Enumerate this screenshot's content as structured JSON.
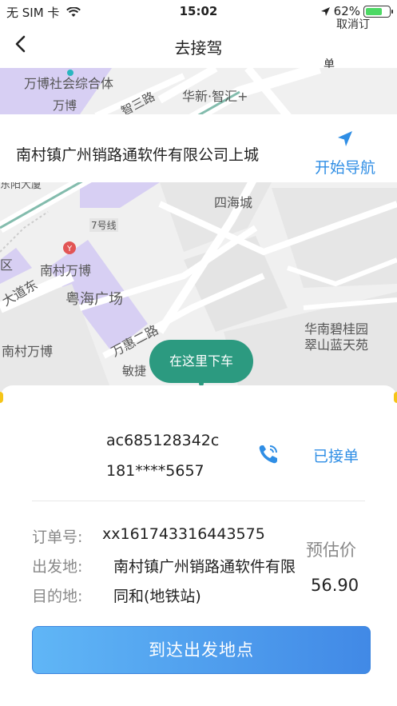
{
  "status_bar": {
    "carrier": "无 SIM 卡",
    "time": "15:02",
    "battery": "62%"
  },
  "nav": {
    "title": "去接驾",
    "right_peek_1": "取消订",
    "right_peek_2": "单"
  },
  "map": {
    "labels": {
      "wanbo_complex": "万博社会综合体",
      "wanbo_road_top": "万博",
      "zhisan_road": "智三路",
      "huaxin": "华新·智汇+",
      "sihaicheng": "四海城",
      "line7": "7号线",
      "nancun_wanbo_station": "南村万博",
      "qu": "区",
      "dadao_dong": "大道东",
      "yuehai_plaza": "粤海广场",
      "wanhui_road2": "万惠二路",
      "nancun_wanbo": "南村万博",
      "huanan_biguiyuan": "华南碧桂园",
      "cuishan_lantian": "翠山蓝天苑",
      "minjie": "敏捷",
      "dongxia": "东阳大厦"
    },
    "dropoff_label": "在这里下车"
  },
  "address_card": {
    "address": "南村镇广州销路通软件有限公司上城",
    "nav_button": "开始导航"
  },
  "order": {
    "user_id": "ac685128342c",
    "phone": "181****5657",
    "status": "已接单",
    "order_no_label": "订单号:",
    "order_no": "xx161743316443575",
    "origin_label": "出发地:",
    "origin": "南村镇广州销路通软件有限",
    "destination_label": "目的地:",
    "destination": "同和(地铁站)",
    "price_label": "预估价",
    "price": "56.90",
    "arrive_button": "到达出发地点"
  },
  "colors": {
    "accent_blue": "#2f8ee5",
    "dropoff_green": "#2c9a80",
    "battery_green": "#4cd964"
  }
}
